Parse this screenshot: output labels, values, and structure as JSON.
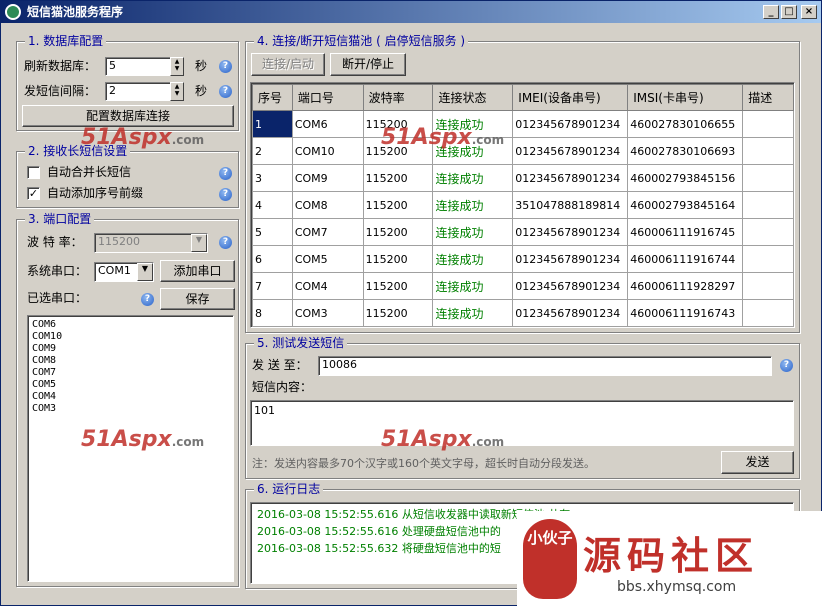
{
  "window": {
    "title": "短信猫池服务程序",
    "minimize": "_",
    "maximize": "□",
    "close": "×"
  },
  "db": {
    "legend": "1. 数据库配置",
    "refresh_label": "刷新数据库：",
    "refresh_value": "5",
    "refresh_unit": "秒",
    "send_label": "发短信间隔：",
    "send_value": "2",
    "send_unit": "秒",
    "config_button": "配置数据库连接"
  },
  "recv": {
    "legend": "2. 接收长短信设置",
    "merge_label": "自动合并长短信",
    "merge_checked": false,
    "prefix_label": "自动添加序号前缀",
    "prefix_checked": true
  },
  "port": {
    "legend": "3. 端口配置",
    "baud_label": "波 特 率：",
    "baud_value": "115200",
    "sys_label": "系统串口：",
    "sys_value": "COM1",
    "add_button": "添加串口",
    "selected_label": "已选串口：",
    "save_button": "保存",
    "selected_ports": [
      "COM6",
      "COM10",
      "COM9",
      "COM8",
      "COM7",
      "COM5",
      "COM4",
      "COM3"
    ]
  },
  "conn": {
    "legend": "4. 连接/断开短信猫池 ( 启停短信服务 )",
    "connect_button": "连接/启动",
    "disconnect_button": "断开/停止",
    "columns": [
      "序号",
      "端口号",
      "波特率",
      "连接状态",
      "IMEI(设备串号)",
      "IMSI(卡串号)",
      "描述"
    ],
    "rows": [
      [
        "1",
        "COM6",
        "115200",
        "连接成功",
        "012345678901234",
        "460027830106655",
        ""
      ],
      [
        "2",
        "COM10",
        "115200",
        "连接成功",
        "012345678901234",
        "460027830106693",
        ""
      ],
      [
        "3",
        "COM9",
        "115200",
        "连接成功",
        "012345678901234",
        "460002793845156",
        ""
      ],
      [
        "4",
        "COM8",
        "115200",
        "连接成功",
        "351047888189814",
        "460002793845164",
        ""
      ],
      [
        "5",
        "COM7",
        "115200",
        "连接成功",
        "012345678901234",
        "460006111916745",
        ""
      ],
      [
        "6",
        "COM5",
        "115200",
        "连接成功",
        "012345678901234",
        "460006111916744",
        ""
      ],
      [
        "7",
        "COM4",
        "115200",
        "连接成功",
        "012345678901234",
        "460006111928297",
        ""
      ],
      [
        "8",
        "COM3",
        "115200",
        "连接成功",
        "012345678901234",
        "460006111916743",
        ""
      ]
    ]
  },
  "test": {
    "legend": "5. 测试发送短信",
    "to_label": "发 送 至：",
    "to_value": "10086",
    "content_label": "短信内容：",
    "content_value": "101",
    "note": "注：发送内容最多70个汉字或160个英文字母，超长时自动分段发送。",
    "send_button": "发送"
  },
  "log": {
    "legend": "6. 运行日志",
    "lines": [
      "2016-03-08 15:52:55.616 从短信收发器中读取新短信池 共有",
      "2016-03-08 15:52:55.616 处理硬盘短信池中的",
      "2016-03-08 15:52:55.632 将硬盘短信池中的短"
    ]
  },
  "watermark": {
    "brand": "51Aspx",
    "suffix": ".com"
  },
  "stamp": {
    "seal": "小伙子",
    "title": "源码社区",
    "url": "bbs.xhymsq.com"
  },
  "colors": {
    "accent": "#0a246a",
    "ok": "#008000",
    "legend": "#0000a0"
  }
}
